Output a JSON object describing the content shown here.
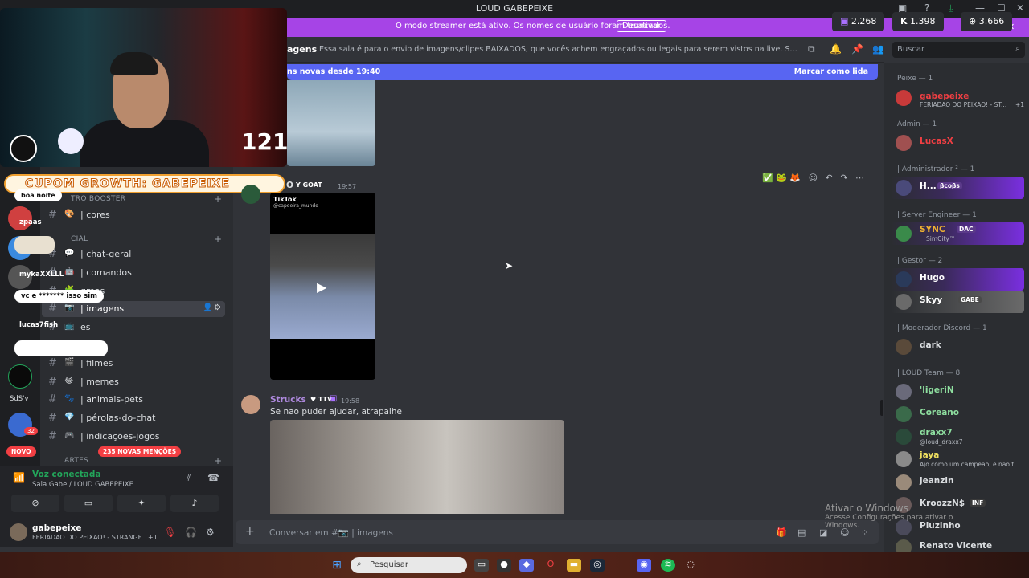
{
  "window": {
    "title": "LOUD GABEPEIXE",
    "minimize": "—",
    "maximize": "☐",
    "close": "✕"
  },
  "streamer_banner": {
    "message": "O modo streamer está ativo. Os nomes de usuário foram truncados.",
    "button": "Desativar",
    "close": "✕"
  },
  "stats": {
    "twitch": "2.268",
    "kick": "1.398",
    "total": "3.666"
  },
  "channel_header": {
    "name": "agens",
    "topic": "Essa sala é para o envio de imagens/clipes BAIXADOS, que vocês achem engraçados ou legais para serem vistos na live. Serão apagados prints de o...",
    "search_placeholder": "Buscar"
  },
  "new_messages_bar": {
    "label": "ns novas desde 19:40",
    "action": "Marcar como lida"
  },
  "webcam": {
    "viewer_count": "121"
  },
  "coupon": {
    "text": "CUPOM GROWTH: GABEPEIXE"
  },
  "overlay_chat": [
    {
      "name": "zpaas",
      "text": "boa noite"
    },
    {
      "name": "mykaXXLLL",
      "text": "vc e ******* isso sim"
    },
    {
      "name": "lucas7fish",
      "text": ""
    }
  ],
  "sidebar": {
    "categories": [
      {
        "label": "TRO BOOSTER"
      },
      {
        "label": "CIAL"
      },
      {
        "label": "ARTES"
      }
    ],
    "channels": [
      {
        "emoji": "🎨",
        "label": "| cores",
        "selected": false
      },
      {
        "emoji": "💬",
        "label": "| chat-geral",
        "selected": false
      },
      {
        "emoji": "🤖",
        "label": "| comandos",
        "selected": false
      },
      {
        "emoji": "🧩",
        "label": "gmas",
        "selected": false
      },
      {
        "emoji": "📷",
        "label": "| imagens",
        "selected": true
      },
      {
        "emoji": "📺",
        "label": "es",
        "selected": false
      },
      {
        "emoji": "🎬",
        "label": "| filmes",
        "selected": false
      },
      {
        "emoji": "😂",
        "label": "| memes",
        "selected": false
      },
      {
        "emoji": "🐾",
        "label": "| animais-pets",
        "selected": false
      },
      {
        "emoji": "💎",
        "label": "| pérolas-do-chat",
        "selected": false
      },
      {
        "emoji": "🎮",
        "label": "| indicações-jogos",
        "selected": false
      }
    ],
    "mentions_badge": "235 NOVAS MENÇÕES",
    "new_badge": "NOVO",
    "server_labels": [
      "SdS'v"
    ],
    "server_badge": "32"
  },
  "voice": {
    "status": "Voz conectada",
    "room": "Sala Gabe / LOUD GABEPEIXE"
  },
  "user": {
    "name": "gabepeixe",
    "status": "FERIADAO DO PEIXAO! - STRANGE...",
    "extra": "+1"
  },
  "messages": [
    {
      "author": "O",
      "tag": "GOAT",
      "time": "19:57",
      "video_label": "TikTok",
      "video_user": "@capoeira_mundo"
    },
    {
      "author": "Strucks",
      "tag": "TTV",
      "time": "19:58",
      "text": "Se nao puder ajudar, atrapalhe"
    }
  ],
  "composer": {
    "placeholder": "Conversar em #📷 | imagens"
  },
  "members": {
    "roles": [
      {
        "label": "Peixe — 1"
      },
      {
        "label": "Admin — 1"
      },
      {
        "label": "| Administrador ² — 1"
      },
      {
        "label": "| Server Engineer — 1"
      },
      {
        "label": "| Gestor — 2"
      },
      {
        "label": "| Moderador Discord — 1"
      },
      {
        "label": "| LOUD Team — 8"
      }
    ],
    "list": [
      {
        "name": "gabepeixe",
        "status": "FERIADAO DO PEIXAO! - ST...",
        "extra": "+1",
        "color": "#f23f43"
      },
      {
        "name": "LucasX",
        "status": "",
        "color": "#f23f43"
      },
      {
        "name": "H...",
        "status": "",
        "tag": "βcoβs",
        "color": "#fff"
      },
      {
        "name": "SYNC",
        "status": "SimCity™",
        "tag": "DAC",
        "color": "#f0b232"
      },
      {
        "name": "Hugo",
        "status": "",
        "color": "#fff"
      },
      {
        "name": "Skyy",
        "status": "",
        "tag": "GABE",
        "color": "#fff"
      },
      {
        "name": "dark",
        "status": "",
        "color": "#dbdee1"
      },
      {
        "name": "'ligeriN",
        "status": "",
        "color": "#8fe0a0"
      },
      {
        "name": "Coreano",
        "status": "",
        "color": "#8fe0a0"
      },
      {
        "name": "draxx7",
        "status": "@loud_draxx7",
        "color": "#8fe0a0"
      },
      {
        "name": "jaya",
        "status": "Ajo como um campeão, e não faria...",
        "color": "#f0e060"
      },
      {
        "name": "jeanzin",
        "status": "",
        "color": "#dbdee1"
      },
      {
        "name": "KroozzN$",
        "status": "",
        "tag": "INF",
        "color": "#dbdee1"
      },
      {
        "name": "Piuzinho",
        "status": "",
        "color": "#dbdee1"
      },
      {
        "name": "Renato Vicente",
        "status": "",
        "color": "#dbdee1"
      }
    ]
  },
  "activation_watermark": {
    "title": "Ativar o Windows",
    "subtitle": "Acesse Configurações para ativar o Windows."
  },
  "taskbar": {
    "search_placeholder": "Pesquisar"
  },
  "colors": {
    "accent": "#5865f2",
    "banner": "#a644e6",
    "online": "#23a55a",
    "danger": "#f23f43"
  }
}
